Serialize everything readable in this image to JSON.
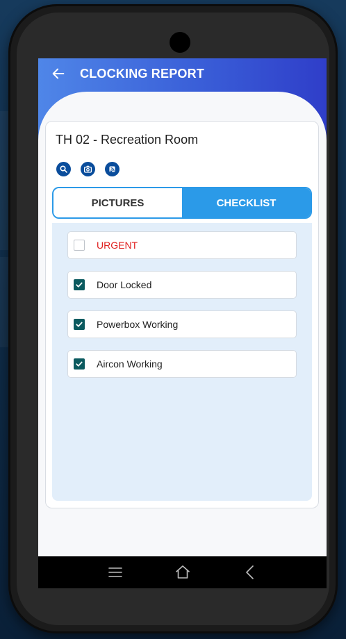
{
  "header": {
    "title": "CLOCKING REPORT",
    "back_icon": "arrow-left-icon"
  },
  "location": {
    "title": "TH 02 - Recreation Room",
    "actions": [
      {
        "icon": "search-icon"
      },
      {
        "icon": "camera-icon"
      },
      {
        "icon": "nfc-icon"
      }
    ]
  },
  "tabs": [
    {
      "label": "PICTURES",
      "active": false
    },
    {
      "label": "CHECKLIST",
      "active": true
    }
  ],
  "checklist": [
    {
      "label": "URGENT",
      "checked": false,
      "color": "#e0201f"
    },
    {
      "label": "Door Locked",
      "checked": true
    },
    {
      "label": "Powerbox Working",
      "checked": true
    },
    {
      "label": "Aircon Working",
      "checked": true
    }
  ],
  "system_nav": {
    "menu_icon": "menu-icon",
    "home_icon": "home-icon",
    "back_icon": "back-chevron-icon"
  },
  "colors": {
    "accent": "#2b9ae8",
    "checkbox": "#0b5a5f",
    "icon_bg": "#0a4d9c"
  }
}
